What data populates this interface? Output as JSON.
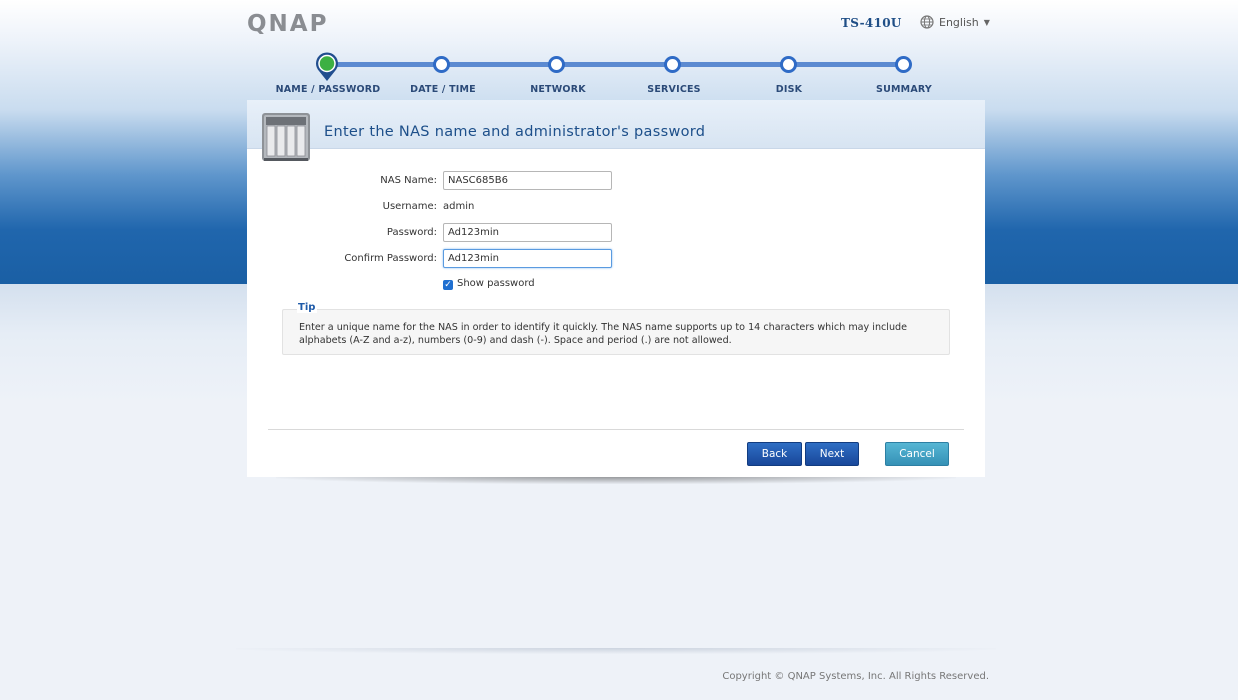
{
  "header": {
    "logo_text": "QNAP",
    "model": "TS-410U",
    "language": "English"
  },
  "steps": [
    {
      "label": "NAME / PASSWORD",
      "active": true
    },
    {
      "label": "DATE / TIME",
      "active": false
    },
    {
      "label": "NETWORK",
      "active": false
    },
    {
      "label": "SERVICES",
      "active": false
    },
    {
      "label": "DISK",
      "active": false
    },
    {
      "label": "SUMMARY",
      "active": false
    }
  ],
  "panel": {
    "title": "Enter the NAS name and administrator's password"
  },
  "form": {
    "nas_name_label": "NAS Name:",
    "nas_name_value": "NASC685B6",
    "username_label": "Username:",
    "username_value": "admin",
    "password_label": "Password:",
    "password_value": "Ad123min",
    "confirm_label": "Confirm Password:",
    "confirm_value": "Ad123min",
    "show_password_label": "Show password",
    "show_password_checked": true
  },
  "tip": {
    "title": "Tip",
    "text": "Enter a unique name for the NAS in order to identify it quickly. The NAS name supports up to 14 characters which may include alphabets (A-Z and a-z), numbers (0-9) and dash (-). Space and period (.) are not allowed."
  },
  "buttons": {
    "back": "Back",
    "next": "Next",
    "cancel": "Cancel"
  },
  "footer": {
    "copyright": "Copyright © QNAP Systems, Inc. All Rights Reserved."
  },
  "colors": {
    "accent": "#1d4f8a",
    "active_step": "#3cb043",
    "button_primary": "#19479a",
    "button_cancel": "#3591b6"
  }
}
